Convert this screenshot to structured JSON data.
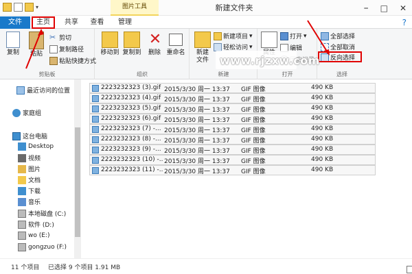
{
  "window": {
    "title": "新建文件夹",
    "context_tab": "图片工具",
    "minimize": "–",
    "maximize": "□",
    "close": "✕"
  },
  "tabs": {
    "file": "文件",
    "home": "主页",
    "share": "共享",
    "view": "查看",
    "manage": "管理",
    "help": "?"
  },
  "ribbon": {
    "clipboard": {
      "label": "剪贴板",
      "copy": "复制",
      "paste": "粘贴",
      "cut": "剪切",
      "copy_path": "复制路径",
      "paste_shortcut": "粘贴快捷方式"
    },
    "organize": {
      "label": "组织",
      "move_to": "移动到",
      "copy_to": "复制到",
      "delete": "删除",
      "rename": "重命名"
    },
    "new": {
      "label": "新建",
      "new_folder": "新建",
      "new_folder_line2": "文件",
      "new_item": "新建项目",
      "easy_access": "轻松访问"
    },
    "open": {
      "label": "打开",
      "properties": "属性",
      "open": "打开",
      "edit": "编辑",
      "history": "历史记录"
    },
    "select": {
      "label": "选择",
      "select_all": "全部选择",
      "select_none": "全部取消",
      "invert": "反向选择"
    },
    "watermark": "www.rjzxw.com"
  },
  "nav": {
    "recent": "最近访问的位置",
    "homegroup": "家庭组",
    "this_pc": "这台电脑",
    "items": [
      "Desktop",
      "视频",
      "图片",
      "文档",
      "下载",
      "音乐"
    ],
    "drives": [
      "本地磁盘 (C:)",
      "软件 (D:)",
      "wo (E:)",
      "gongzuo (F:)"
    ]
  },
  "files": [
    {
      "name": "2223232323 (3).gif",
      "date": "2015/3/30 周一 13:37",
      "type": "GIF 图像",
      "size": "490 KB"
    },
    {
      "name": "2223232323 (4).gif",
      "date": "2015/3/30 周一 13:37",
      "type": "GIF 图像",
      "size": "490 KB"
    },
    {
      "name": "2223232323 (5).gif",
      "date": "2015/3/30 周一 13:37",
      "type": "GIF 图像",
      "size": "490 KB"
    },
    {
      "name": "2223232323 (6).gif",
      "date": "2015/3/30 周一 13:37",
      "type": "GIF 图像",
      "size": "490 KB"
    },
    {
      "name": "2223232323 (7) -...",
      "date": "2015/3/30 周一 13:37",
      "type": "GIF 图像",
      "size": "490 KB"
    },
    {
      "name": "2223232323 (8) -...",
      "date": "2015/3/30 周一 13:37",
      "type": "GIF 图像",
      "size": "490 KB"
    },
    {
      "name": "2223232323 (9) -...",
      "date": "2015/3/30 周一 13:37",
      "type": "GIF 图像",
      "size": "490 KB"
    },
    {
      "name": "2223232323 (10) -...",
      "date": "2015/3/30 周一 13:37",
      "type": "GIF 图像",
      "size": "490 KB"
    },
    {
      "name": "2223232323 (11) -...",
      "date": "2015/3/30 周一 13:37",
      "type": "GIF 图像",
      "size": "490 KB"
    }
  ],
  "status": {
    "count": "11 个项目",
    "selected": "已选择 9 个项目  1.91 MB"
  },
  "colors": {
    "accent": "#1979ca",
    "highlight_box": "#e00000",
    "context_tab": "#fff7c9"
  }
}
